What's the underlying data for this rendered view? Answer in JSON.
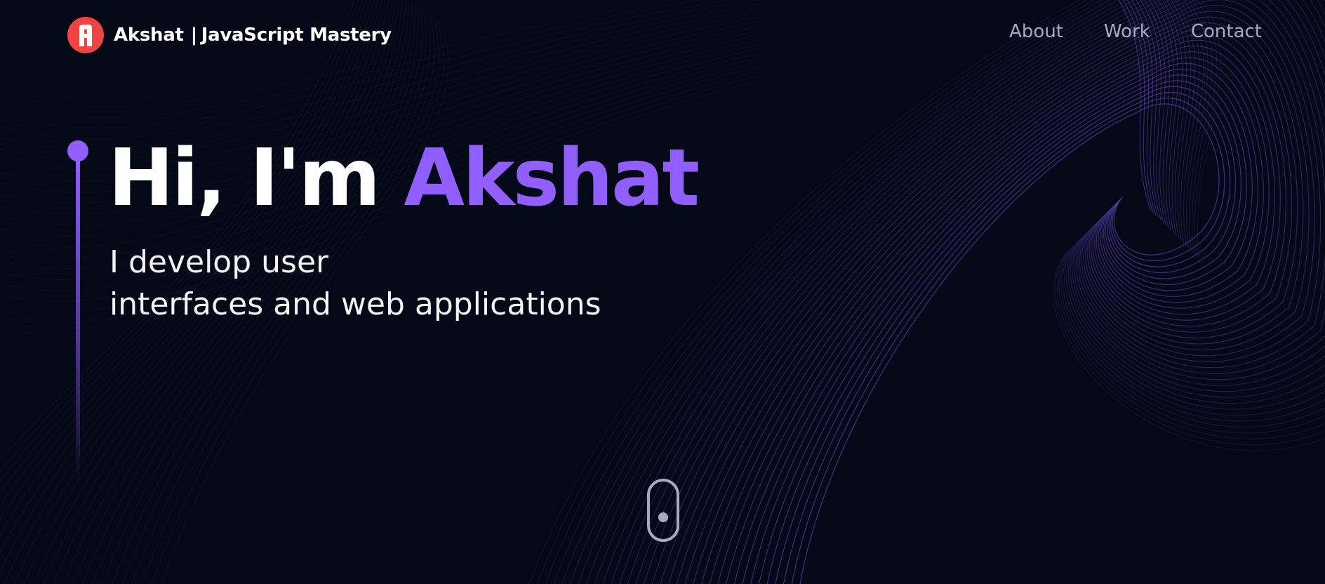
{
  "colors": {
    "background": "#050816",
    "accent": "#915eff",
    "nav_text": "#aaa6c3",
    "logo_badge": "#ef4444",
    "text": "#ffffff"
  },
  "navbar": {
    "logo_name": "Akshat",
    "logo_separator": "|",
    "logo_subtitle": "JavaScript Mastery",
    "logo_icon": "logo-icon",
    "links": [
      {
        "label": "About"
      },
      {
        "label": "Work"
      },
      {
        "label": "Contact"
      }
    ]
  },
  "hero": {
    "greeting": "Hi, I'm",
    "name": "Akshat",
    "subtitle_line1": "I develop user",
    "subtitle_line2": "interfaces and web applications"
  },
  "scroll_indicator": {
    "icon": "mouse-scroll-icon"
  }
}
